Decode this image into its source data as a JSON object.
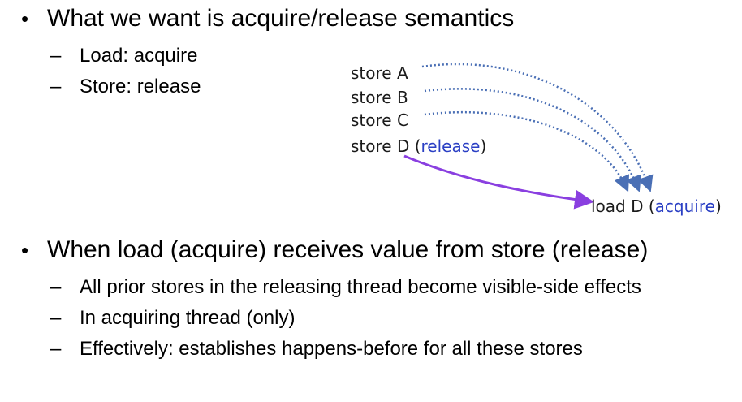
{
  "colors": {
    "text": "#000000",
    "keyword_blue": "#2a3fc4",
    "dotted_arrow": "#4a6fb5",
    "purple_arrow": "#8a3fe0"
  },
  "bullets": [
    {
      "text": "What we want is acquire/release semantics",
      "subitems": [
        "Load: acquire",
        "Store: release"
      ]
    },
    {
      "text": "When load (acquire) receives value from store (release)",
      "subitems": [
        "All prior stores in the releasing thread become visible-side effects",
        "In acquiring thread (only)",
        "Effectively: establishes happens-before for all these stores"
      ]
    }
  ],
  "diagram": {
    "stores": [
      "store A",
      "store B",
      "store C"
    ],
    "store_d": {
      "prefix": "store D (",
      "keyword": "release",
      "suffix": ")"
    },
    "load_d": {
      "prefix": "load D (",
      "keyword": "acquire",
      "suffix": ")"
    }
  }
}
